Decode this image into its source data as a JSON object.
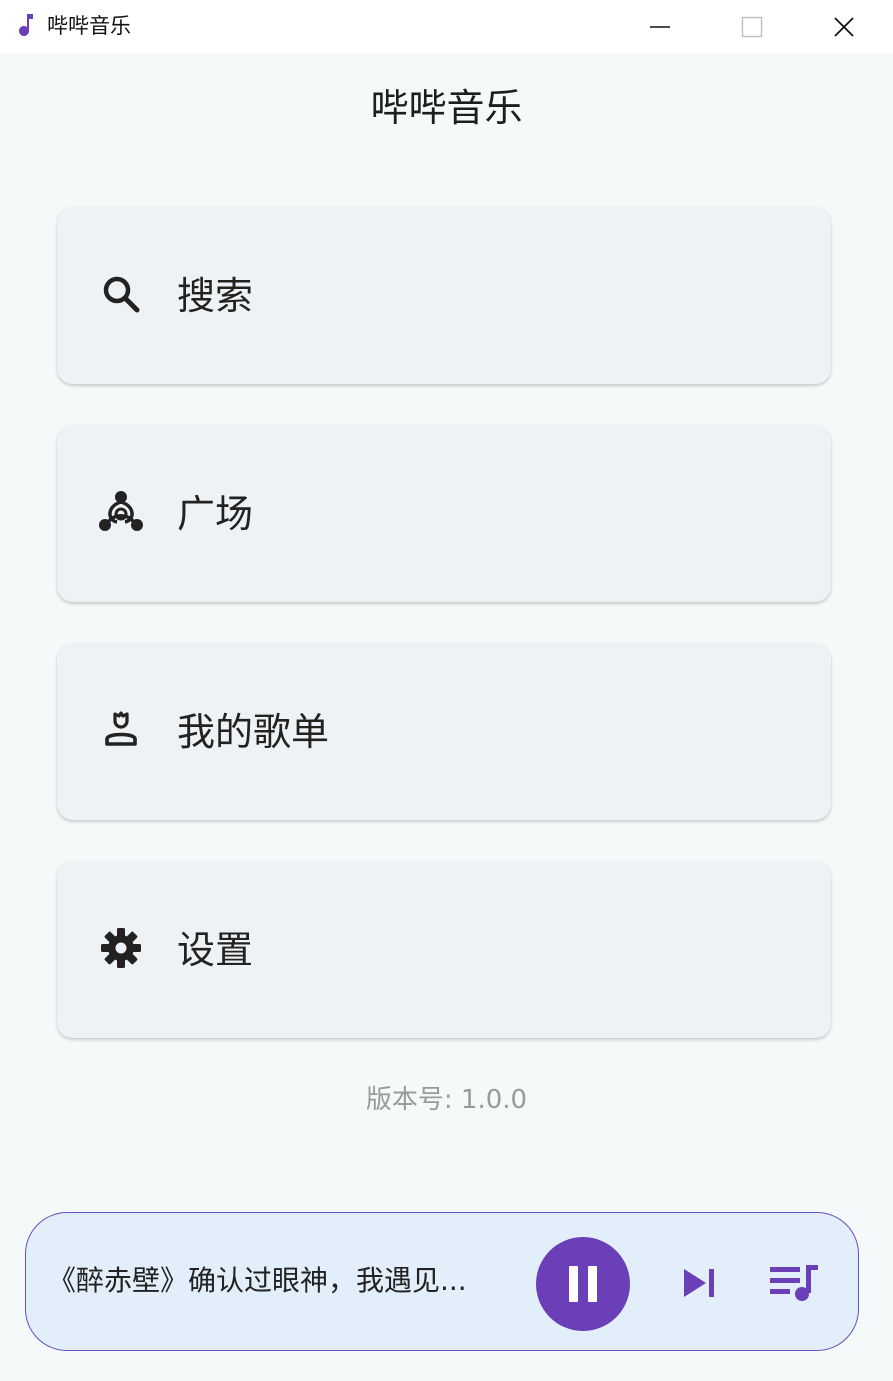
{
  "window": {
    "title": "哔哔音乐",
    "controls": [
      "minimize-icon",
      "maximize-icon",
      "close-icon"
    ]
  },
  "page": {
    "title": "哔哔音乐"
  },
  "menu": [
    {
      "label": "搜索",
      "icon": "search-icon"
    },
    {
      "label": "广场",
      "icon": "hub-icon"
    },
    {
      "label": "我的歌单",
      "icon": "user-playlist-icon"
    },
    {
      "label": "设置",
      "icon": "gear-icon"
    }
  ],
  "footer": {
    "version": "版本号: 1.0.0"
  },
  "player": {
    "now_playing": "《醉赤壁》确认过眼神，我遇见...",
    "state": "playing",
    "buttons": [
      "pause-icon",
      "skip-next-icon",
      "queue-music-icon"
    ]
  },
  "colors": {
    "accent": "#6a3fb8",
    "card_bg": "#eef2f4",
    "page_bg": "#f4f9f9",
    "player_bg": "#e2eefa",
    "version_text": "#9a9a9a"
  }
}
